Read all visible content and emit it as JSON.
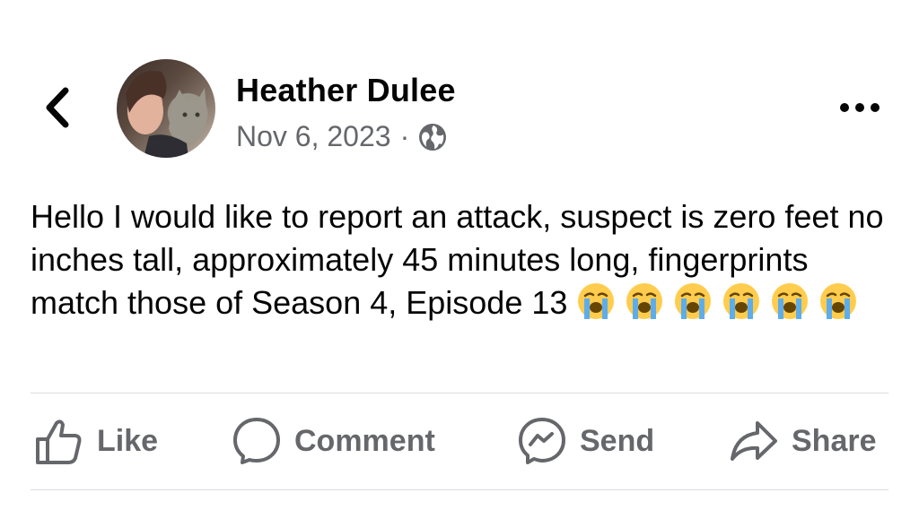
{
  "post": {
    "author": "Heather Dulee",
    "date": "Nov 6, 2023",
    "separator": "·",
    "visibility_icon": "globe-icon",
    "text": "Hello I would like to report an attack, suspect is zero feet no inches tall, approximately 45 minutes long, fingerprints match those of Season 4, Episode 13",
    "emojis": [
      "loudly-crying-face",
      "loudly-crying-face",
      "loudly-crying-face",
      "loudly-crying-face",
      "loudly-crying-face",
      "loudly-crying-face"
    ]
  },
  "header": {
    "back_icon": "chevron-left-icon",
    "more_icon": "more-dots-icon"
  },
  "actions": {
    "like": "Like",
    "comment": "Comment",
    "send": "Send",
    "share": "Share"
  },
  "colors": {
    "text": "#050505",
    "secondary": "#65676b",
    "divider": "#dadde1",
    "emoji_face": "#ffcc4d",
    "tears": "#5dadec"
  }
}
